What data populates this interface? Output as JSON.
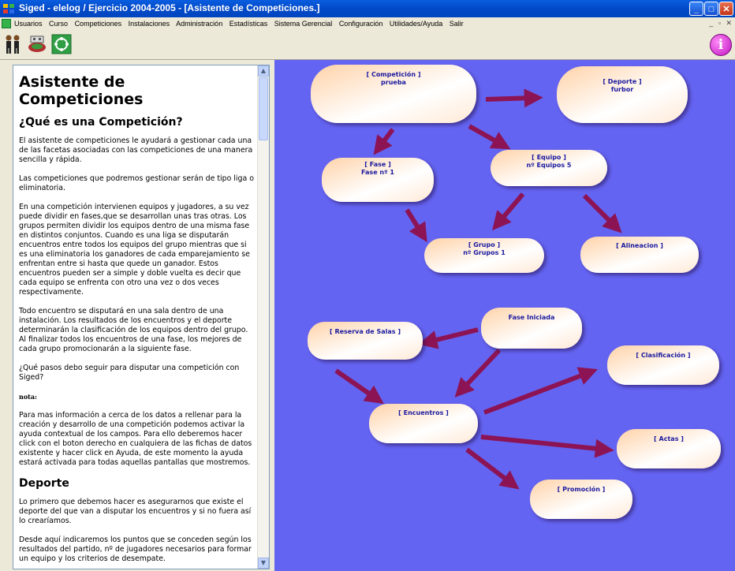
{
  "window": {
    "title": "Siged - elelog / Ejercicio 2004-2005 - [Asistente de Competiciones.]"
  },
  "menu": {
    "items": [
      "Usuarios",
      "Curso",
      "Competiciones",
      "Instalaciones",
      "Administración",
      "Estadísticas",
      "Sistema Gerencial",
      "Configuración",
      "Utilidades/Ayuda",
      "Salir"
    ]
  },
  "help": {
    "title": "Asistente de Competiciones",
    "section1_title": "¿Qué es una Competición?",
    "paragraphs1": [
      "El asistente de competiciones le ayudará a gestionar cada una de las facetas asociadas con las competiciones de una manera sencilla y rápida.",
      "Las competiciones que podremos gestionar serán de tipo liga o eliminatoria.",
      "En una competición intervienen equipos y jugadores, a su vez puede dividir en fases,que se desarrollan unas tras otras. Los grupos permiten dividir los equipos dentro de una misma fase en distintos conjuntos. Cuando es una liga se disputarán encuentros entre todos los equipos del grupo mientras que si es una eliminatoria los ganadores de cada emparejamiento se enfrentan entre si hasta que quede un ganador. Estos encuentros pueden ser a simple y doble vuelta es decir que cada equipo se enfrenta con otro una vez o dos veces respectivamente.",
      "Todo encuentro se disputará en una sala dentro de una instalación. Los resultados de los encuentros y el deporte determinarán la clasificación de los equipos dentro del grupo. Al finalizar todos los encuentros de una fase, los mejores de cada grupo promocionarán a la siguiente fase.",
      "¿Qué pasos debo seguir para disputar una competición con Siged?"
    ],
    "nota_label": "nota:",
    "nota_text": "Para mas información a cerca de los datos a rellenar para la creación y desarrollo de una competición podemos activar la ayuda contextual de los campos. Para ello deberemos hacer click con el boton derecho en cualquiera de las fichas de datos existente y hacer click en Ayuda, de este momento la ayuda estará activada para todas aquellas pantallas que mostremos.",
    "section2_title": "Deporte",
    "paragraphs2": [
      "Lo primero que debemos hacer es asegurarnos que existe el deporte del que van a disputar los encuentros y si no fuera así lo crearíamos.",
      "Desde aquí indicaremos los puntos que se conceden según los resultados del partido, nº de jugadores necesarios para formar un equipo y los criterios de desempate."
    ]
  },
  "diagram": {
    "competicion": {
      "line1": "[ Competición ]",
      "line2": "prueba"
    },
    "deporte": {
      "line1": "[ Deporte ]",
      "line2": "furbor"
    },
    "fase": {
      "line1": "[ Fase ]",
      "line2": "Fase nº 1"
    },
    "equipo": {
      "line1": "[ Equipo ]",
      "line2": "nº Equipos 5"
    },
    "grupo": {
      "line1": "[ Grupo ]",
      "line2": "nº Grupos 1"
    },
    "alineacion": {
      "line1": "[ Alineacion ]"
    },
    "fase_iniciada": {
      "line1": "Fase Iniciada"
    },
    "reserva": {
      "line1": "[ Reserva de Salas ]"
    },
    "clasificacion": {
      "line1": "[ Clasificación ]"
    },
    "encuentros": {
      "line1": "[ Encuentros ]"
    },
    "actas": {
      "line1": "[ Actas ]"
    },
    "promocion": {
      "line1": "[ Promoción ]"
    },
    "arrow_color": "#8c1454"
  }
}
